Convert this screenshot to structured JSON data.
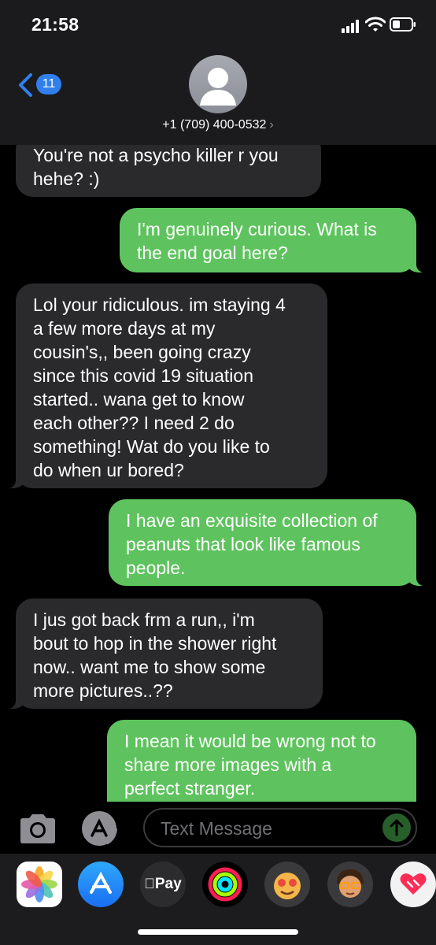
{
  "status_bar": {
    "time": "21:58"
  },
  "header": {
    "back_badge": "11",
    "contact": "+1 (709) 400-0532",
    "contact_chevron": "›"
  },
  "messages": [
    {
      "direction": "received",
      "text": "You're not a psycho killer r you\nhehe? :)"
    },
    {
      "direction": "sent",
      "text": "I'm genuinely curious. What is\nthe end goal here?"
    },
    {
      "direction": "received",
      "text": "Lol your ridiculous. im staying 4\na few more days at my\ncousin's,, been going crazy\nsince this covid 19 situation\nstarted.. wana get to know\neach other?? I need 2 do\nsomething! Wat do you like to\ndo when ur bored?"
    },
    {
      "direction": "sent",
      "text": "I have an exquisite collection of\npeanuts that look like famous\npeople."
    },
    {
      "direction": "received",
      "text": "I jus got back frm a run,, i'm\nbout to hop in the shower right\nnow..  want me to show some\nmore pictures..??"
    },
    {
      "direction": "sent",
      "text": "I mean it would be wrong not to\nshare more images with a\nperfect stranger."
    }
  ],
  "composer": {
    "placeholder": "Text Message"
  },
  "app_drawer": {
    "apps": [
      {
        "icon": "photos-icon"
      },
      {
        "icon": "app-store-icon"
      },
      {
        "icon": "apple-pay-icon",
        "label": "Pay"
      },
      {
        "icon": "activity-icon"
      },
      {
        "icon": "animoji-icon"
      },
      {
        "icon": "memoji-icon"
      },
      {
        "icon": "digital-touch-icon"
      }
    ]
  },
  "colors": {
    "sent_bubble": "#5ec35e",
    "received_bubble": "#2a2a2d",
    "header_bg": "#1b1b1d",
    "badge": "#2f80ed"
  }
}
